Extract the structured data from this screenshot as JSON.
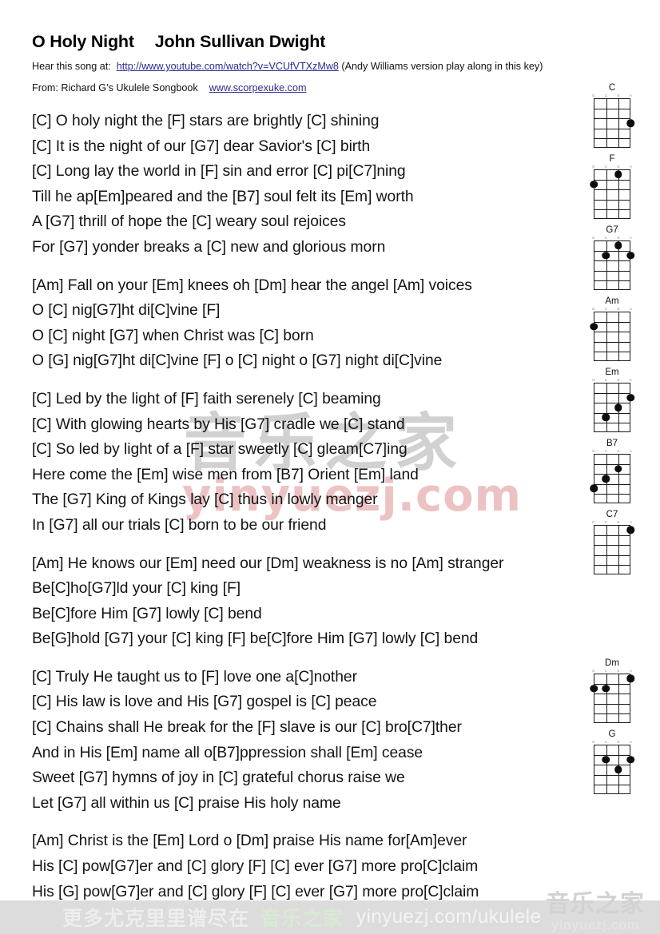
{
  "header": {
    "song_title": "O Holy Night",
    "author": "John Sullivan Dwight",
    "hear_label": "Hear this song at:",
    "youtube_url": "http://www.youtube.com/watch?v=VCUfVTXzMw8",
    "youtube_note": "(Andy Williams version play along in this key)",
    "from_label": "From:  Richard G’s Ukulele Songbook",
    "source_url": "www.scorpexuke.com"
  },
  "lyrics": {
    "verses": [
      {
        "id": "verse-1",
        "lines": [
          "[C] O holy night the [F] stars are brightly [C] shining",
          "[C] It is the night of our [G7] dear Savior's [C] birth",
          "[C] Long lay the world in [F] sin and error [C] pi[C7]ning",
          "Till he ap[Em]peared and the [B7] soul felt its [Em] worth",
          "A [G7] thrill of hope the [C] weary soul rejoices",
          "For [G7] yonder breaks a [C] new and glorious morn"
        ]
      },
      {
        "id": "chorus-1",
        "lines": [
          "[Am] Fall on your [Em] knees oh [Dm] hear the angel [Am] voices",
          "O [C] nig[G7]ht di[C]vine [F]",
          "O [C] night [G7] when Christ was [C] born",
          "O [G] nig[G7]ht di[C]vine [F] o [C] night o [G7] night di[C]vine"
        ]
      },
      {
        "id": "verse-2",
        "lines": [
          "[C] Led by the light of [F] faith serenely [C] beaming",
          "[C] With glowing hearts by His [G7] cradle we [C] stand",
          "[C] So led by light of a [F] star sweetly [C] gleam[C7]ing",
          "Here come the [Em] wise men from [B7] Orient [Em] land",
          "The [G7] King of Kings lay [C] thus in lowly manger",
          "In [G7] all our trials [C] born to be our friend"
        ]
      },
      {
        "id": "chorus-2",
        "lines": [
          "[Am] He knows our [Em] need our [Dm] weakness is no [Am] stranger",
          "Be[C]ho[G7]ld your [C] king [F]",
          "Be[C]fore Him [G7] lowly [C] bend",
          "Be[G]hold [G7] your [C] king [F] be[C]fore Him [G7] lowly [C] bend"
        ]
      },
      {
        "id": "verse-3",
        "lines": [
          "[C] Truly He taught us to [F] love one a[C]nother",
          "[C] His law is love and His [G7] gospel is [C] peace",
          "[C] Chains shall He break for the [F] slave is our [C] bro[C7]ther",
          "And in His [Em] name all o[B7]ppression shall [Em] cease",
          "Sweet [G7] hymns of joy in [C] grateful chorus raise we",
          "Let [G7] all within us [C] praise His holy name"
        ]
      },
      {
        "id": "chorus-3",
        "lines": [
          "[Am] Christ is the [Em] Lord o [Dm] praise His name for[Am]ever",
          "His [C] pow[G7]er and [C] glory [F] [C] ever [G7] more pro[C]claim",
          "His [G] pow[G7]er and [C] glory [F] [C] ever [G7] more pro[C]claim"
        ]
      }
    ]
  },
  "chords": {
    "string_labels": [
      "G",
      "C",
      "E",
      "A"
    ],
    "top_group": [
      {
        "name": "C",
        "dots": [
          {
            "string": 4,
            "fret": 3
          }
        ]
      },
      {
        "name": "F",
        "dots": [
          {
            "string": 3,
            "fret": 1
          },
          {
            "string": 1,
            "fret": 2
          }
        ]
      },
      {
        "name": "G7",
        "dots": [
          {
            "string": 3,
            "fret": 1
          },
          {
            "string": 2,
            "fret": 2
          },
          {
            "string": 4,
            "fret": 2
          }
        ]
      },
      {
        "name": "Am",
        "dots": [
          {
            "string": 1,
            "fret": 2
          }
        ]
      },
      {
        "name": "Em",
        "dots": [
          {
            "string": 4,
            "fret": 2
          },
          {
            "string": 3,
            "fret": 3
          },
          {
            "string": 2,
            "fret": 4
          }
        ]
      },
      {
        "name": "B7",
        "dots": [
          {
            "string": 3,
            "fret": 2
          },
          {
            "string": 2,
            "fret": 3
          },
          {
            "string": 1,
            "fret": 4
          }
        ]
      },
      {
        "name": "C7",
        "dots": [
          {
            "string": 4,
            "fret": 1
          }
        ]
      }
    ],
    "bottom_group": [
      {
        "name": "Dm",
        "dots": [
          {
            "string": 4,
            "fret": 1
          },
          {
            "string": 1,
            "fret": 2
          },
          {
            "string": 2,
            "fret": 2
          }
        ]
      },
      {
        "name": "G",
        "dots": [
          {
            "string": 2,
            "fret": 2
          },
          {
            "string": 4,
            "fret": 2
          },
          {
            "string": 3,
            "fret": 3
          }
        ]
      }
    ]
  },
  "watermarks": {
    "center_cn": "音乐之家",
    "center_url": "yinyuezj.com",
    "corner_cn": "音乐之家",
    "corner_url": "yinyuezj.com"
  },
  "footer": {
    "cn_text": "更多尤克里里谱尽在",
    "cn_brand": "音乐之家",
    "url": "yinyuezj.com/ukulele"
  }
}
